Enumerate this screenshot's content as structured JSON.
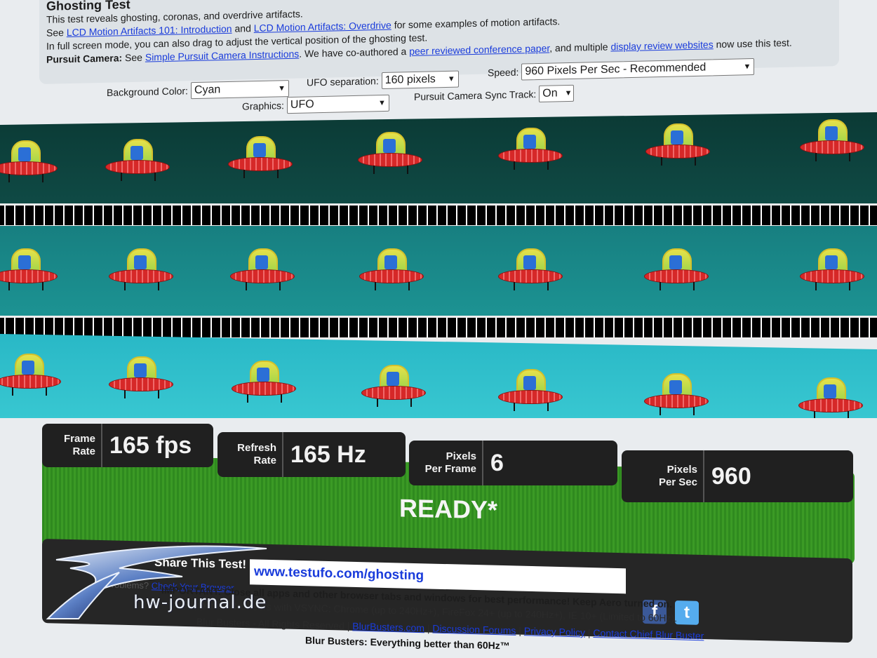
{
  "header": {
    "title": "Ghosting Test",
    "line1": "This test reveals ghosting, coronas, and overdrive artifacts.",
    "line2_prefix": "See",
    "link1": "LCD Motion Artifacts 101: Introduction",
    "line2_mid": "and",
    "link2": "LCD Motion Artifacts: Overdrive",
    "line2_suffix": "for some examples of motion artifacts.",
    "line3": "In full screen mode, you can also drag to adjust the vertical position of the ghosting test.",
    "line4_bold": "Pursuit Camera:",
    "line4_see": "See",
    "link3": "Simple Pursuit Camera Instructions",
    "line4_mid": ". We have co-authored a",
    "link4": "peer reviewed conference paper",
    "line4_mid2": ", and multiple",
    "link5": "display review websites",
    "line4_end": "now use this test."
  },
  "controls": {
    "background_label": "Background Color:",
    "background_value": "Cyan",
    "separation_label": "UFO separation:",
    "separation_value": "160 pixels",
    "speed_label": "Speed:",
    "speed_value": "960 Pixels Per Sec - Recommended",
    "graphics_label": "Graphics:",
    "graphics_value": "UFO",
    "sync_label": "Pursuit Camera Sync Track:",
    "sync_value": "On"
  },
  "stats": {
    "frame_rate_label_1": "Frame",
    "frame_rate_label_2": "Rate",
    "frame_rate_value": "165 fps",
    "refresh_label_1": "Refresh",
    "refresh_label_2": "Rate",
    "refresh_value": "165 Hz",
    "ppf_label_1": "Pixels",
    "ppf_label_2": "Per Frame",
    "ppf_value": "6",
    "pps_label_1": "Pixels",
    "pps_label_2": "Per Sec",
    "pps_value": "960"
  },
  "status": {
    "text": "READY*"
  },
  "share": {
    "label": "Share This Test!",
    "url": "www.testufo.com/ghosting"
  },
  "footer": {
    "important": "IMPORTANT: Close all apps and other browser tabs and windows for best performance! Keep Aero turned on.",
    "supported": "Supported Browsers with VSYNC: Chrome (up to 240Hz+), FireFox 24+ (up to 240Hz+), IE 10+ (Limited to 60Hz).",
    "problems": "Problems?",
    "check_browser": "Check Your Browser",
    "copyright": "Blur Busters - All Rights Reserved |",
    "link_site": "BlurBusters.com",
    "link_forums": "Discussion Forums",
    "link_privacy": "Privacy Policy",
    "link_contact": "Contact Chief Blur Buster",
    "tagline": "Blur Busters: Everything better than 60Hz™"
  },
  "watermark": {
    "text": "hw-journal.de"
  },
  "colors": {
    "band_dark": "#0f4a45",
    "band_mid": "#1c9393",
    "band_light": "#38c7d1",
    "ready_green": "#3b9a25",
    "link_blue": "#1a3cdb",
    "panel_dark": "#202020"
  },
  "icons": [
    "facebook-icon",
    "twitter-icon",
    "ufo-icon"
  ]
}
